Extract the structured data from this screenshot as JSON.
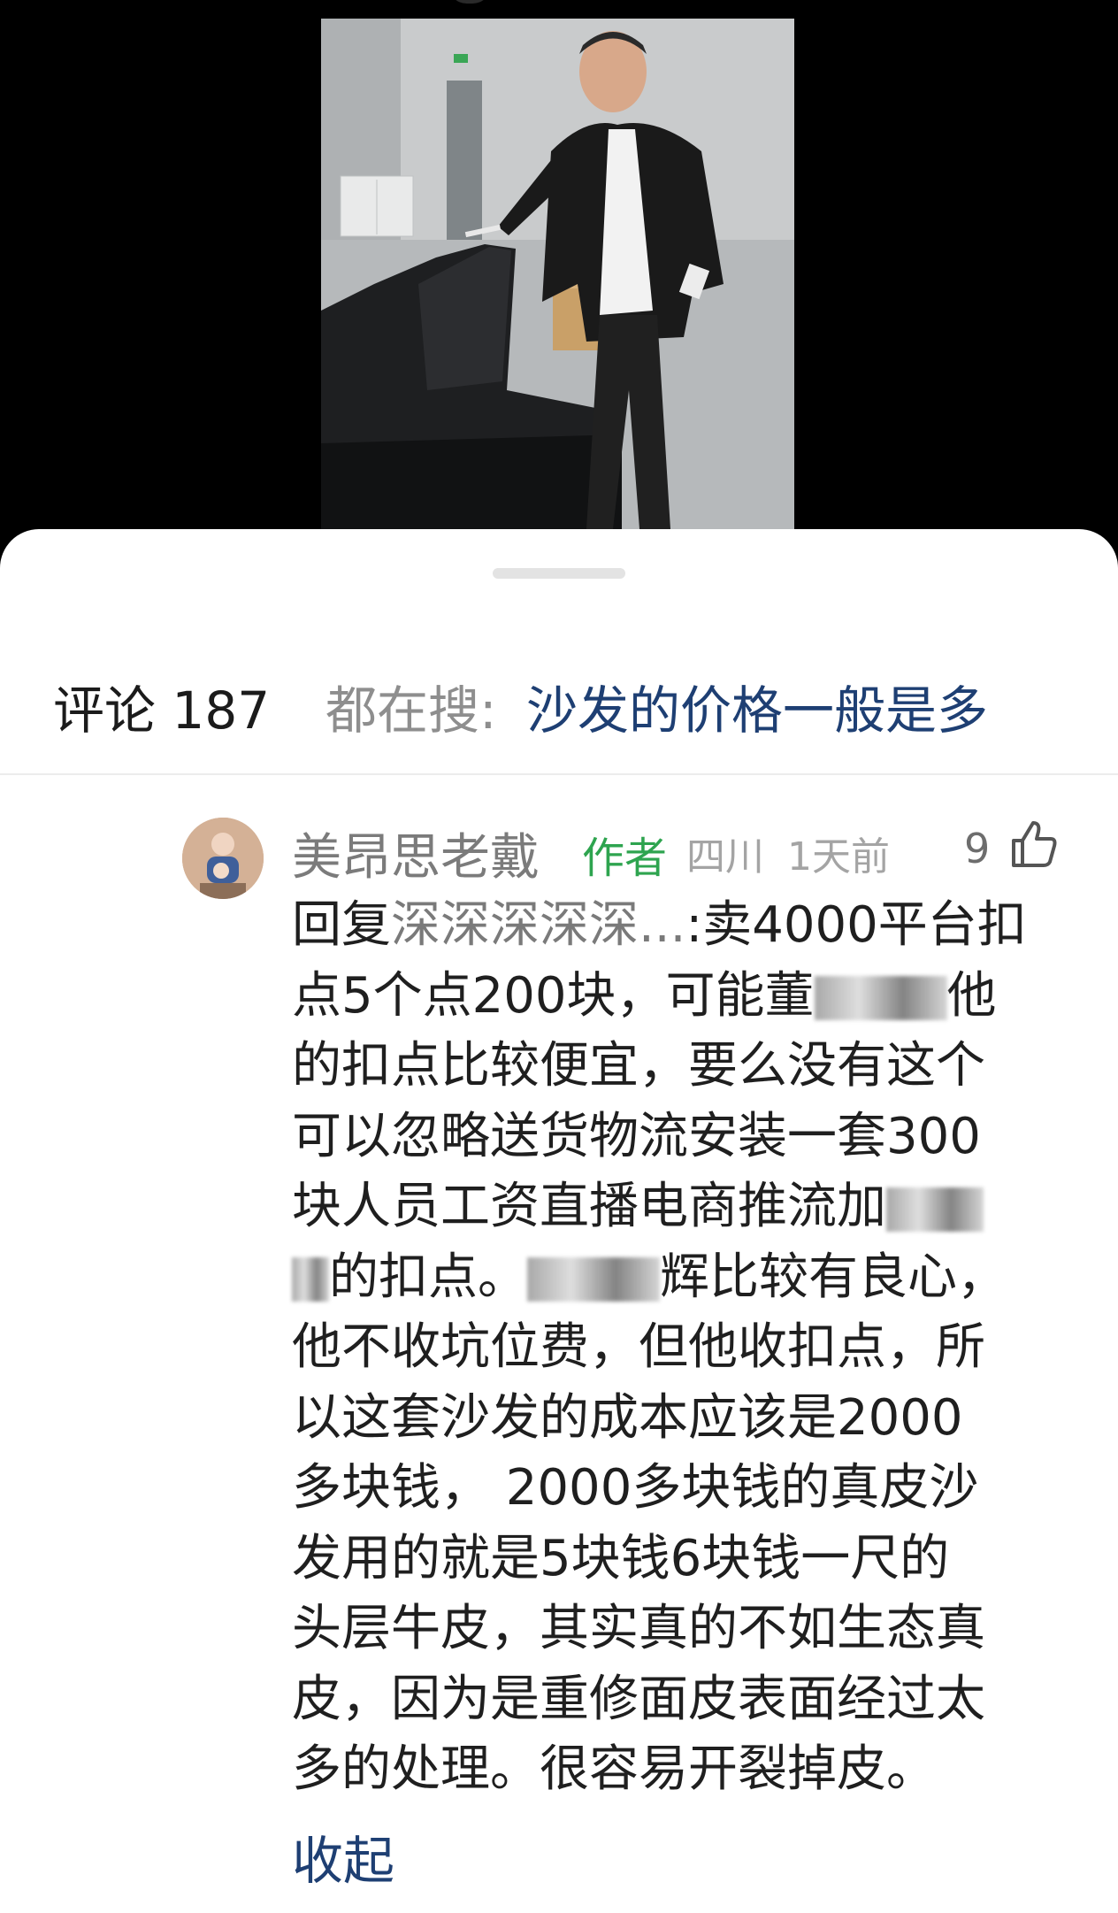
{
  "video": {},
  "header": {
    "count_label": "评论 187",
    "search_prefix": "都在搜:",
    "search_query": "沙发的价格一般是多"
  },
  "comment": {
    "author": "美昂思老戴",
    "author_tag": "作者",
    "location": "四川",
    "time": "1天前",
    "likes": "9",
    "reply_prefix": "回复",
    "reply_target": "深深深深深...",
    "lines": [
      ":卖4000平台扣",
      "点5个点200块，可能董",
      "的扣点比较便宜，要么没有这个",
      "可以忽略送货物流安装一套300",
      "块人员工资直播电商推流加",
      "的扣点。",
      "辉比较有良心，",
      "他不收坑位费，但他收扣点，所",
      "以这套沙发的成本应该是2000",
      "多块钱， 2000多块钱的真皮沙",
      "发用的就是5块钱6块钱一尺的",
      "头层牛皮，其实真的不如生态真",
      "皮，因为是重修面皮表面经过太",
      "多的处理。很容易开裂掉皮。"
    ],
    "line2_tail": "他",
    "collapse_label": "收起"
  },
  "colors": {
    "link_blue": "#1e3f73",
    "author_green": "#2ea44f",
    "muted_gray": "#8e8e8e"
  }
}
